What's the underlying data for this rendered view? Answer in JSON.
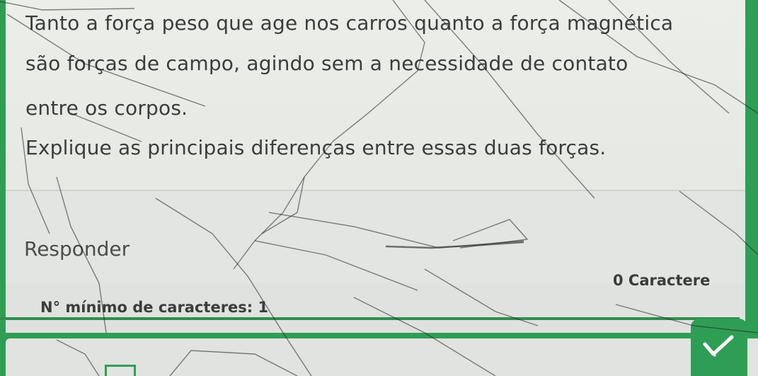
{
  "question": {
    "line1": "Tanto a força peso que age nos carros quanto a força magnética",
    "line2": "são forças de campo, agindo sem a necessidade de contato",
    "line3": "entre os corpos.",
    "line4": "Explique as principais diferenças entre essas duas forças."
  },
  "answer": {
    "placeholder": "Responder",
    "char_count": "0 Caractere",
    "min_chars": "N° mínimo de caracteres: 1"
  },
  "submit": {
    "icon": "checkmark-icon"
  },
  "colors": {
    "accent": "#2f9e55",
    "background": "#e6e8e4",
    "text": "#3a3d3a"
  }
}
